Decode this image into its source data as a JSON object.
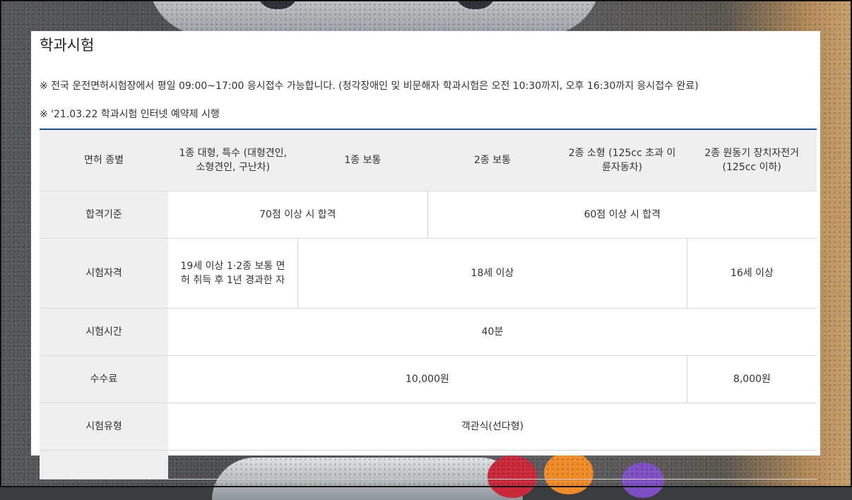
{
  "page": {
    "title": "학과시험",
    "notices": [
      "※ 전국 운전면허시험장에서 평일 09:00~17:00 응시접수 가능합니다. (청각장애인 및 비문해자 학과시험은 오전 10:30까지, 오후 16:30까지 응시접수 완료)",
      "※ '21.03.22 학과시험 인터넷 예약제 시행"
    ]
  },
  "table": {
    "header": {
      "label": "면허 종별",
      "columns": [
        "1종 대형, 특수 (대형견인, 소형견인, 구난차)",
        "1종 보통",
        "2종 보통",
        "2종 소형 (125cc 초과 이륜자동차)",
        "2종 원동기 장치자전거 (125cc 이하)"
      ]
    },
    "rows": {
      "pass": {
        "label": "합격기준",
        "values": [
          "70점 이상 시 합격",
          "60점 이상 시 합격"
        ]
      },
      "qualification": {
        "label": "시험자격",
        "values": [
          "19세 이상 1·2종 보통 면허 취득 후 1년 경과한 자",
          "18세 이상",
          "16세 이상"
        ]
      },
      "duration": {
        "label": "시험시간",
        "value": "40분"
      },
      "fee": {
        "label": "수수료",
        "values": [
          "10,000원",
          "8,000원"
        ]
      },
      "type": {
        "label": "시험유형",
        "value": "객관식(선다형)"
      }
    }
  },
  "colors": {
    "accent_rule": "#1a4fa0",
    "header_bg": "#efefef",
    "border": "#d8d8d8"
  }
}
